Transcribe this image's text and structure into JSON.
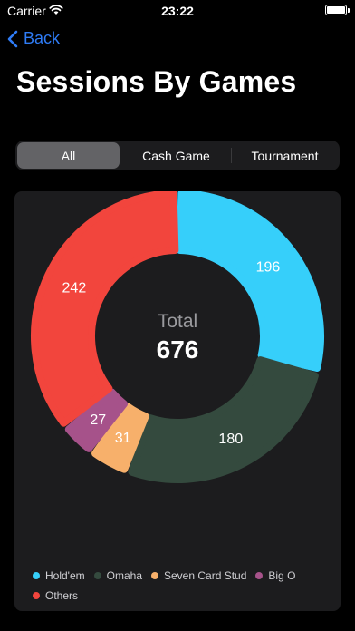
{
  "status_bar": {
    "carrier": "Carrier",
    "time": "23:22"
  },
  "nav": {
    "back_label": "Back"
  },
  "title": "Sessions By Games",
  "segments": [
    {
      "label": "All",
      "selected": true
    },
    {
      "label": "Cash Game",
      "selected": false
    },
    {
      "label": "Tournament",
      "selected": false
    }
  ],
  "center": {
    "label": "Total",
    "value": "676"
  },
  "chart_data": {
    "type": "pie",
    "donut": true,
    "total": 676,
    "title": "",
    "slices": [
      {
        "name": "Hold'em",
        "value": 196,
        "color": "#36cffa"
      },
      {
        "name": "Omaha",
        "value": 180,
        "color": "#344a3e"
      },
      {
        "name": "Seven Card Stud",
        "value": 31,
        "color": "#f7b06b"
      },
      {
        "name": "Big O",
        "value": 27,
        "color": "#a6528a"
      },
      {
        "name": "Others",
        "value": 242,
        "color": "#f2453d"
      }
    ],
    "legend_position": "bottom-left"
  },
  "colors": {
    "accent": "#2f7cf6",
    "background": "#000000",
    "card": "#1c1c1e"
  }
}
